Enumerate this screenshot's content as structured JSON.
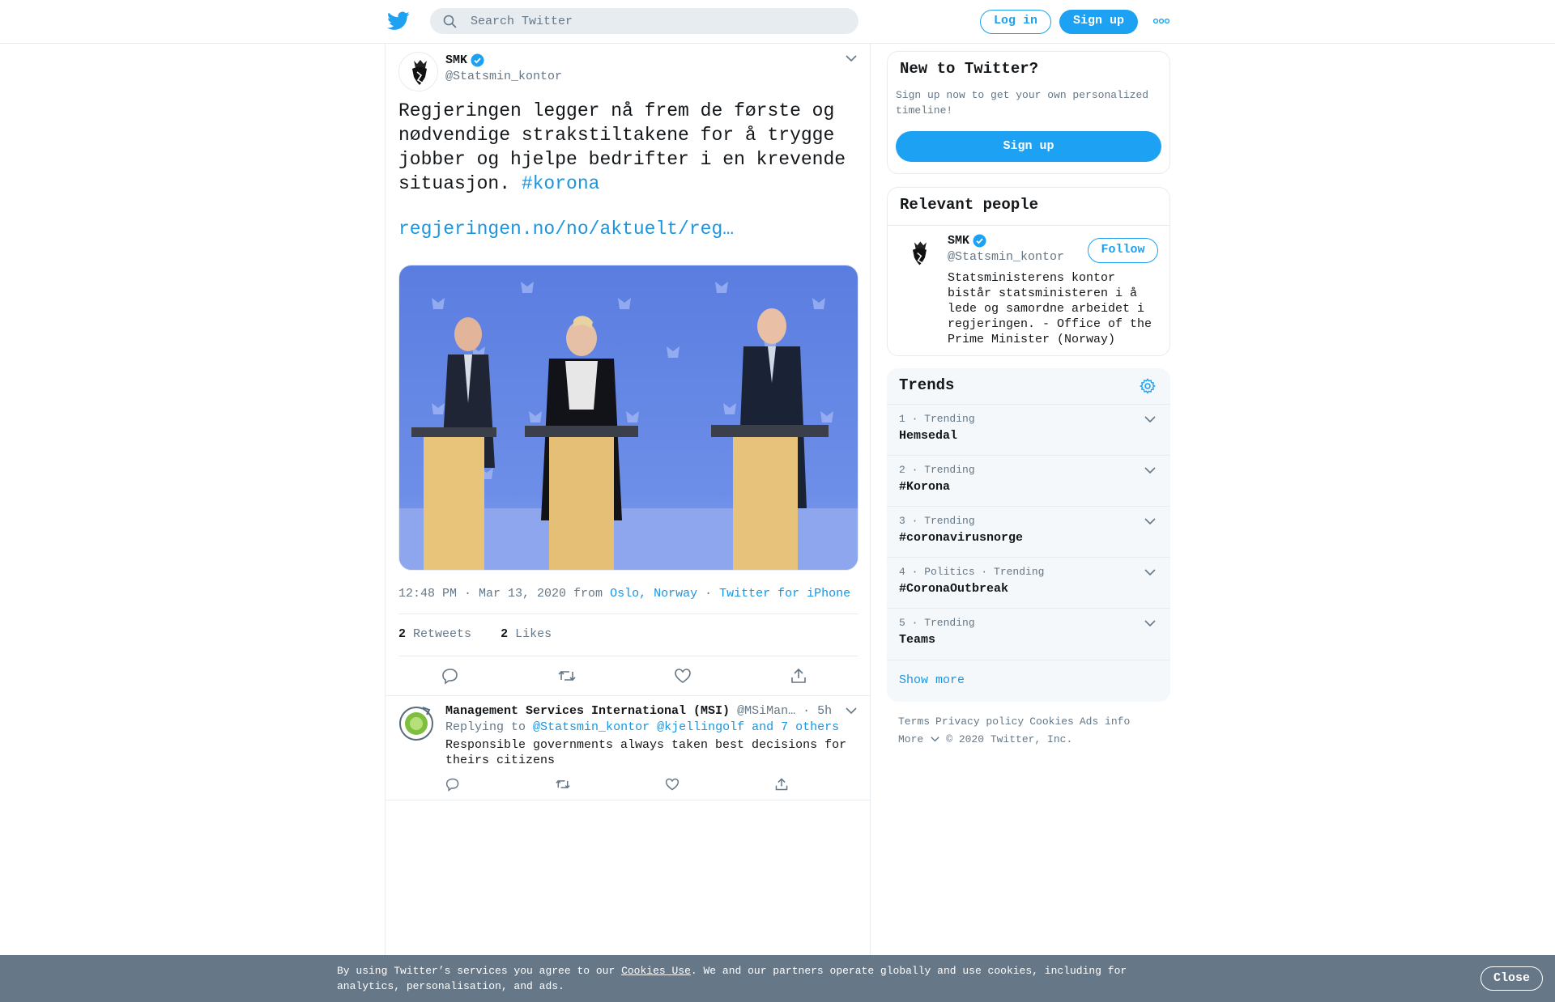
{
  "header": {
    "search_placeholder": "Search Twitter",
    "login_label": "Log in",
    "signup_label": "Sign up",
    "more_icon": "more-dots-icon"
  },
  "tweet": {
    "name": "SMK",
    "handle": "@Statsmin_kontor",
    "text": "Regjeringen legger nå frem de første og nødvendige strakstiltakene for å trygge jobber og hjelpe bedrifter i en krevende situasjon. ",
    "hashtag": "#korona",
    "link": "regjeringen.no/no/aktuelt/reg…",
    "time": "12:48 PM · Mar 13, 2020 from",
    "location": "Oslo, Norway",
    "dot": "·",
    "source": "Twitter for iPhone",
    "retweet_count": "2",
    "retweet_label": "Retweets",
    "like_count": "2",
    "like_label": "Likes"
  },
  "reply": {
    "name": "Management Services International (MSI)",
    "handle": "@MSiMan…",
    "time": "· 5h",
    "replying_label": "Replying to",
    "replying_to": "@Statsmin_kontor @kjellingolf and 7 others",
    "text": "Responsible governments always taken best decisions for theirs citizens"
  },
  "new_to_twitter": {
    "title": "New to Twitter?",
    "desc": "Sign up now to get your own personalized timeline!",
    "button": "Sign up"
  },
  "relevant": {
    "title": "Relevant people",
    "name": "SMK",
    "handle": "@Statsmin_kontor",
    "follow": "Follow",
    "bio": "Statsministerens kontor bistår statsministeren i å lede og samordne arbeidet i regjeringen. - Office of the Prime Minister (Norway)"
  },
  "trends": {
    "title": "Trends",
    "items": [
      {
        "meta": "1 · Trending",
        "name": "Hemsedal"
      },
      {
        "meta": "2 · Trending",
        "name": "#Korona"
      },
      {
        "meta": "3 · Trending",
        "name": "#coronavirusnorge"
      },
      {
        "meta": "4 · Politics · Trending",
        "name": "#CoronaOutbreak"
      },
      {
        "meta": "5 · Trending",
        "name": "Teams"
      }
    ],
    "show_more": "Show more"
  },
  "footer": {
    "terms": "Terms",
    "privacy": "Privacy policy",
    "cookies": "Cookies",
    "ads": "Ads info",
    "more": "More",
    "copyright": "© 2020 Twitter, Inc."
  },
  "cookie_bar": {
    "text_before": "By using Twitter’s services you agree to our ",
    "link": "Cookies Use",
    "text_after": ". We and our partners operate globally and use cookies, including for analytics, personalisation, and ads.",
    "close": "Close"
  },
  "colors": {
    "accent": "#1da1f2",
    "link": "#1b95e0",
    "muted": "#657786",
    "cookie_bg": "#667788"
  }
}
